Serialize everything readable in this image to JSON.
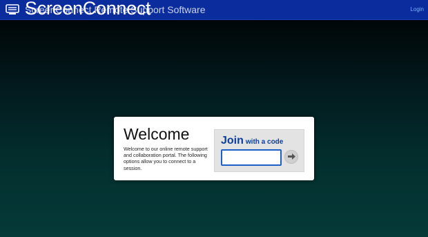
{
  "header": {
    "logo_text": "ScreenConnect",
    "app_title": "ScreenConnect Remote Support Software",
    "login_label": "Login"
  },
  "welcome": {
    "title": "Welcome",
    "text": "Welcome to our online remote support and collaboration portal. The following options allow you to connect to a session."
  },
  "join": {
    "heading": "Join",
    "subheading": "with a code",
    "code_value": "",
    "code_placeholder": ""
  },
  "icons": {
    "logo": "screenconnect-logo-icon",
    "go": "arrow-right-icon"
  },
  "colors": {
    "header_bg": "#0b2c9c",
    "accent": "#0b3d9c",
    "input_border": "#1c5fc9"
  }
}
